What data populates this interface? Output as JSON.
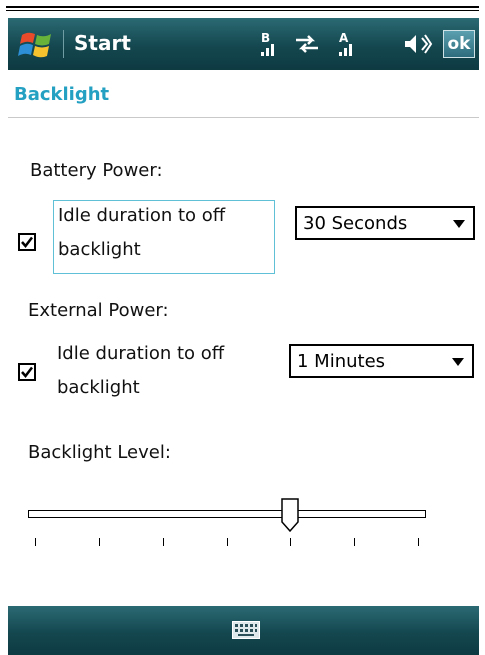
{
  "titlebar": {
    "title": "Start",
    "ok_label": "ok"
  },
  "page": {
    "title": "Backlight"
  },
  "battery": {
    "section_label": "Battery Power:",
    "checkbox_label_line1": "Idle duration to off",
    "checkbox_label_line2": "backlight",
    "checked": true,
    "duration_value": "30 Seconds"
  },
  "external": {
    "section_label": "External Power:",
    "checkbox_label_line1": "Idle duration to off",
    "checkbox_label_line2": "backlight",
    "checked": true,
    "duration_value": "1 Minutes"
  },
  "backlight_level": {
    "label": "Backlight Level:",
    "level": 5,
    "max": 7
  },
  "icons": [
    "windows-logo-icon",
    "bluetooth-signal-icon",
    "sync-arrows-icon",
    "phone-signal-icon",
    "volume-icon",
    "keyboard-icon"
  ]
}
